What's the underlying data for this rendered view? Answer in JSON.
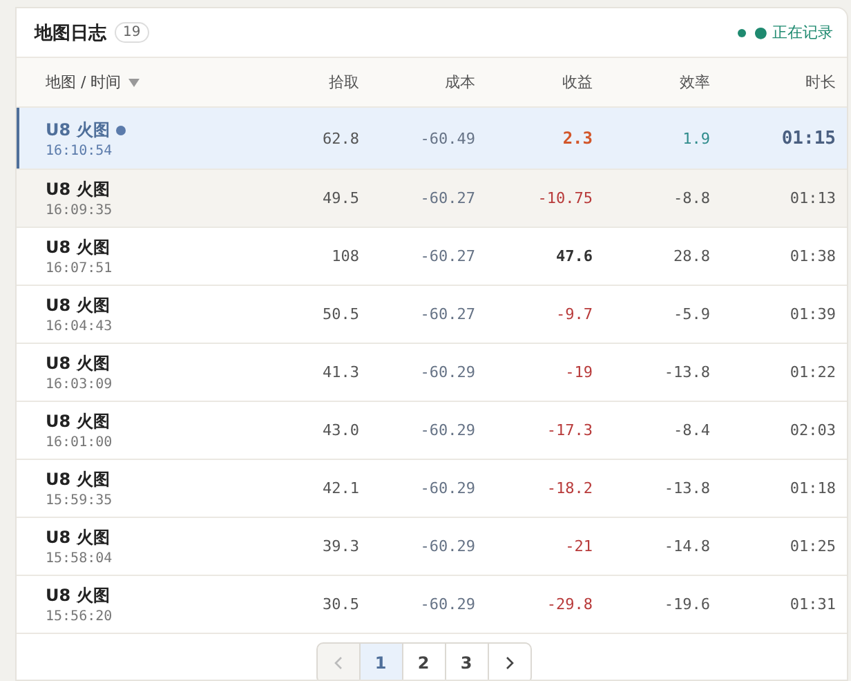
{
  "panel": {
    "title": "地图日志",
    "count": "19",
    "recording": true,
    "status": "● 正在记录"
  },
  "table": {
    "columns": [
      {
        "label": "地图 / 时间",
        "sorted": true
      },
      {
        "label": "拾取",
        "sorted": false
      },
      {
        "label": "成本",
        "sorted": false
      },
      {
        "label": "收益",
        "sorted": false
      },
      {
        "label": "效率",
        "sorted": false
      },
      {
        "label": "时长",
        "sorted": false
      }
    ],
    "rows": [
      {
        "map": "U8 火图",
        "time": "16:10:54",
        "live": true,
        "selected": true,
        "hovered": false,
        "pickup": "62.8",
        "cost": "-60.49",
        "profit": "2.3",
        "loss": false,
        "efficiency": "1.9",
        "duration": "01:15"
      },
      {
        "map": "U8 火图",
        "time": "16:09:35",
        "live": false,
        "selected": false,
        "hovered": true,
        "pickup": "49.5",
        "cost": "-60.27",
        "profit": "-10.75",
        "loss": true,
        "efficiency": "-8.8",
        "duration": "01:13"
      },
      {
        "map": "U8 火图",
        "time": "16:07:51",
        "live": false,
        "selected": false,
        "hovered": false,
        "pickup": "108",
        "cost": "-60.27",
        "profit": "47.6",
        "loss": false,
        "efficiency": "28.8",
        "duration": "01:38"
      },
      {
        "map": "U8 火图",
        "time": "16:04:43",
        "live": false,
        "selected": false,
        "hovered": false,
        "pickup": "50.5",
        "cost": "-60.27",
        "profit": "-9.7",
        "loss": true,
        "efficiency": "-5.9",
        "duration": "01:39"
      },
      {
        "map": "U8 火图",
        "time": "16:03:09",
        "live": false,
        "selected": false,
        "hovered": false,
        "pickup": "41.3",
        "cost": "-60.29",
        "profit": "-19",
        "loss": true,
        "efficiency": "-13.8",
        "duration": "01:22"
      },
      {
        "map": "U8 火图",
        "time": "16:01:00",
        "live": false,
        "selected": false,
        "hovered": false,
        "pickup": "43.0",
        "cost": "-60.29",
        "profit": "-17.3",
        "loss": true,
        "efficiency": "-8.4",
        "duration": "02:03"
      },
      {
        "map": "U8 火图",
        "time": "15:59:35",
        "live": false,
        "selected": false,
        "hovered": false,
        "pickup": "42.1",
        "cost": "-60.29",
        "profit": "-18.2",
        "loss": true,
        "efficiency": "-13.8",
        "duration": "01:18"
      },
      {
        "map": "U8 火图",
        "time": "15:58:04",
        "live": false,
        "selected": false,
        "hovered": false,
        "pickup": "39.3",
        "cost": "-60.29",
        "profit": "-21",
        "loss": true,
        "efficiency": "-14.8",
        "duration": "01:25"
      },
      {
        "map": "U8 火图",
        "time": "15:56:20",
        "live": false,
        "selected": false,
        "hovered": false,
        "pickup": "30.5",
        "cost": "-60.29",
        "profit": "-29.8",
        "loss": true,
        "efficiency": "-19.6",
        "duration": "01:31"
      }
    ]
  },
  "pagination": {
    "prev_disabled": true,
    "next_disabled": false,
    "pages": [
      {
        "label": "1",
        "selected": true
      },
      {
        "label": "2",
        "selected": false
      },
      {
        "label": "3",
        "selected": false
      }
    ]
  }
}
